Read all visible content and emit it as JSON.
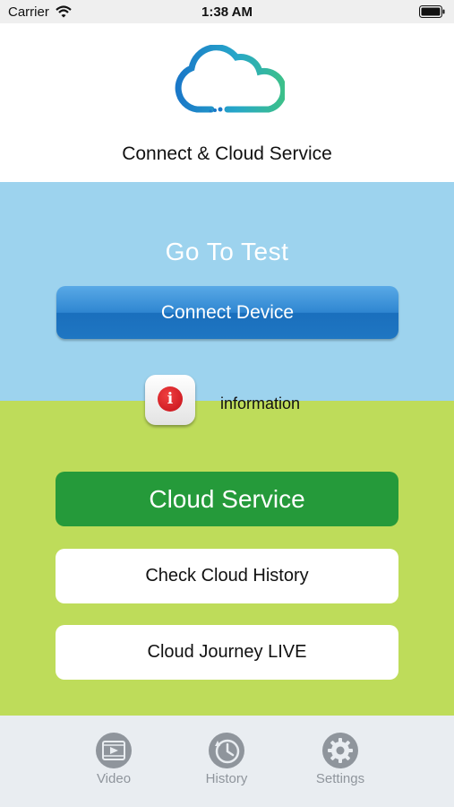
{
  "status_bar": {
    "carrier": "Carrier",
    "time": "1:38 AM"
  },
  "header": {
    "logo_icon": "cloud-logo-icon",
    "title": "Connect & Cloud Service"
  },
  "test_section": {
    "heading": "Go To Test",
    "connect_label": "Connect Device",
    "background": "#9dd3ee"
  },
  "info": {
    "icon": "info-icon",
    "label": "information"
  },
  "cloud_section": {
    "heading_button": "Cloud Service",
    "history_label": "Check Cloud History",
    "journey_label": "Cloud Journey LIVE",
    "background": "#bedc5a",
    "accent": "#259a3a"
  },
  "tabbar": {
    "tabs": [
      {
        "label": "Video",
        "icon": "video-icon"
      },
      {
        "label": "History",
        "icon": "history-clock-icon"
      },
      {
        "label": "Settings",
        "icon": "gear-icon"
      }
    ]
  }
}
